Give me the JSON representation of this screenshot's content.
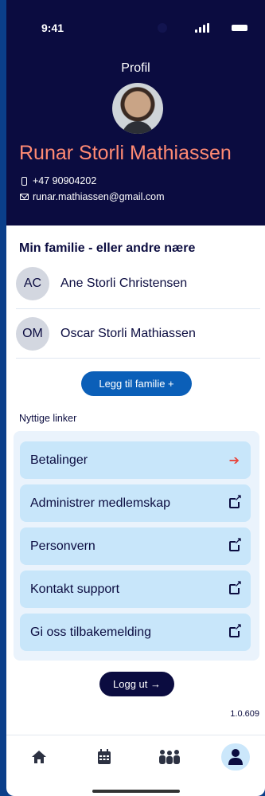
{
  "status_bar": {
    "time": "9:41"
  },
  "profile": {
    "title": "Profil",
    "name": "Runar Storli Mathiassen",
    "phone": "+47 90904202",
    "email": "runar.mathiassen@gmail.com"
  },
  "family": {
    "title": "Min familie - eller andre nære",
    "members": [
      {
        "initials": "AC",
        "name": "Ane Storli Christensen"
      },
      {
        "initials": "OM",
        "name": "Oscar Storli Mathiassen"
      }
    ],
    "add_button": "Legg til familie +"
  },
  "links": {
    "label": "Nyttige linker",
    "items": [
      {
        "label": "Betalinger",
        "icon": "arrow-right-icon"
      },
      {
        "label": "Administrer medlemskap",
        "icon": "external-link-icon"
      },
      {
        "label": "Personvern",
        "icon": "external-link-icon"
      },
      {
        "label": "Kontakt support",
        "icon": "external-link-icon"
      },
      {
        "label": "Gi oss tilbakemelding",
        "icon": "external-link-icon"
      }
    ],
    "arrow_color": "#e8453c"
  },
  "logout": "Logg ut →",
  "version": "1.0.609",
  "tabbar": {
    "items": [
      {
        "icon": "home-icon"
      },
      {
        "icon": "calendar-icon"
      },
      {
        "icon": "group-icon"
      },
      {
        "icon": "person-icon",
        "active": true
      }
    ]
  },
  "colors": {
    "header_bg": "#0b0c40",
    "name_accent": "#ff8a73",
    "primary_button": "#0b5fb8",
    "link_bg": "#c8e6fa"
  }
}
